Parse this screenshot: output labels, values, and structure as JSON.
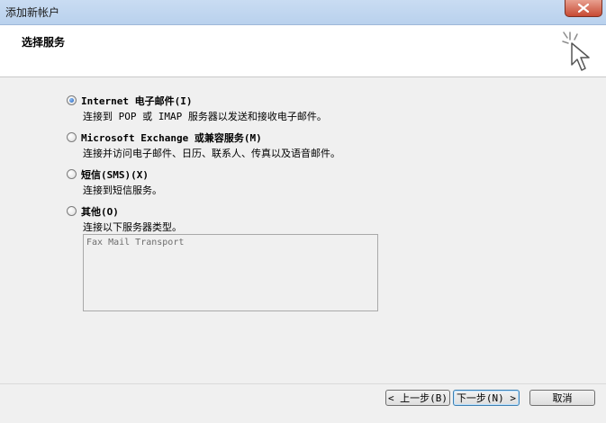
{
  "window": {
    "title": "添加新帐户",
    "close_icon": "close-icon"
  },
  "header": {
    "title": "选择服务",
    "icon": "cursor-sparkle-icon"
  },
  "options": [
    {
      "label": "Internet 电子邮件(I)",
      "description": "连接到 POP 或 IMAP 服务器以发送和接收电子邮件。",
      "selected": true
    },
    {
      "label": "Microsoft Exchange 或兼容服务(M)",
      "description": "连接并访问电子邮件、日历、联系人、传真以及语音邮件。",
      "selected": false
    },
    {
      "label": "短信(SMS)(X)",
      "description": "连接到短信服务。",
      "selected": false
    },
    {
      "label": "其他(O)",
      "description": "连接以下服务器类型。",
      "selected": false
    }
  ],
  "other_types": [
    "Fax Mail Transport"
  ],
  "buttons": {
    "back": "< 上一步(B)",
    "next": "下一步(N) >",
    "cancel": "取消"
  },
  "colors": {
    "titlebar": "#c9dcf2",
    "close_button": "#c74a33",
    "dialog_background": "#f0f0f0",
    "header_background": "#ffffff",
    "default_button_border": "#3c7fb1"
  }
}
